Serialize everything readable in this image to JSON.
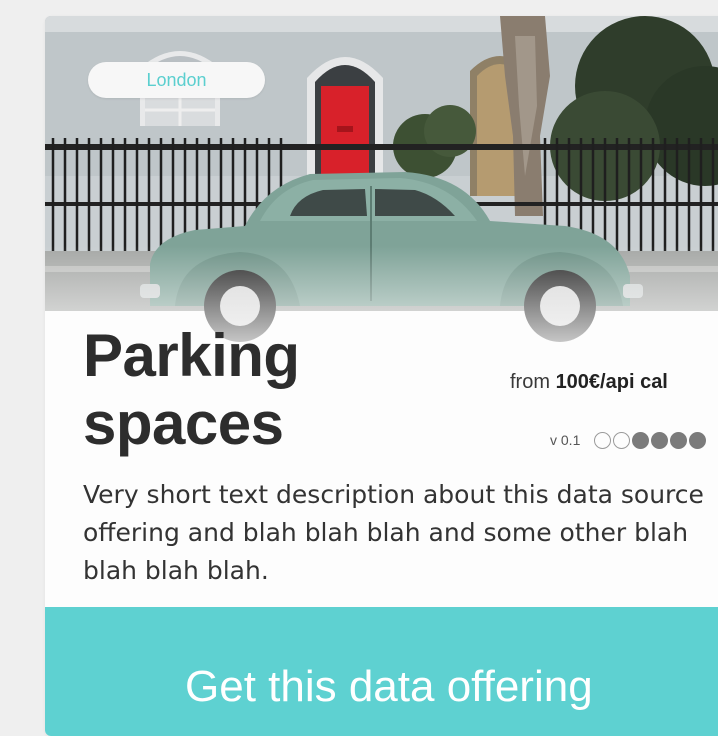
{
  "card": {
    "location_tag": "London",
    "title": "Parking spaces",
    "price_prefix": "from",
    "price_value": "100€/api cal",
    "version": "v 0.1",
    "rating": {
      "total": 6,
      "filled": 4
    },
    "description": "Very short text description about this data source offering and blah blah blah and some other blah blah blah blah.",
    "cta_label": "Get this data offering"
  },
  "colors": {
    "accent": "#5ed1d1",
    "title_text": "#2d2d2d",
    "door": "#d8212a",
    "car": "#7fa398"
  },
  "icons": {
    "rating": "rating-dot-icon"
  }
}
